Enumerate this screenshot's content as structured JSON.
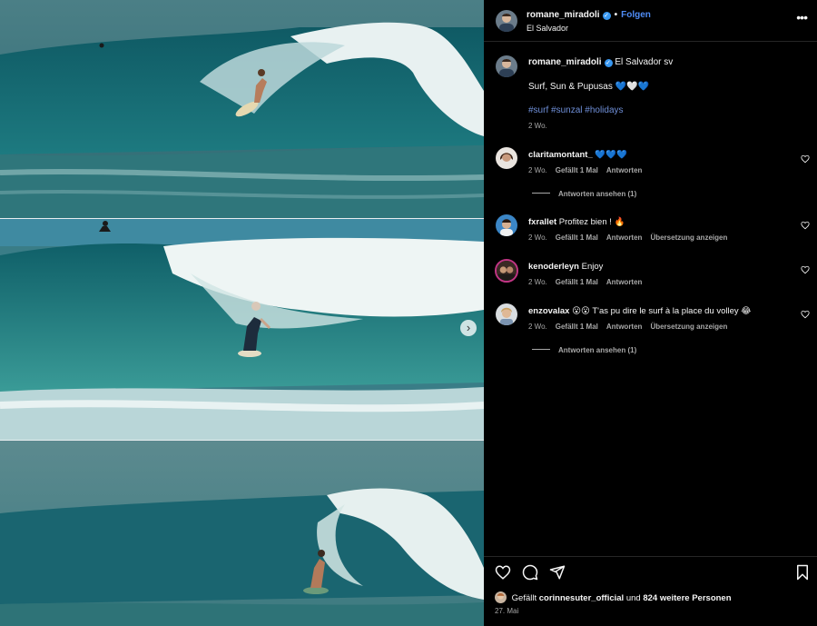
{
  "post": {
    "username": "romane_miradoli",
    "verified_symbol": "✓",
    "dot": "•",
    "follow_label": "Folgen",
    "location": "El Salvador",
    "more_icon": "more-horizontal-icon",
    "more_symbol": "•••"
  },
  "caption": {
    "username": "romane_miradoli",
    "location_tag": "El Salvador sv",
    "text": "Surf, Sun & Pupusas 💙🤍💙",
    "hashtags": [
      "#surf",
      "#sunzal",
      "#holidays"
    ],
    "time": "2 Wo."
  },
  "comments": [
    {
      "username": "claritamontant_",
      "text": "💙💙💙",
      "time": "2 Wo.",
      "likes": "Gefällt 1 Mal",
      "reply": "Antworten",
      "translate": "",
      "view_replies": "Antworten ansehen (1)"
    },
    {
      "username": "fxrallet",
      "text": "Profitez bien ! 🔥",
      "time": "2 Wo.",
      "likes": "Gefällt 1 Mal",
      "reply": "Antworten",
      "translate": "Übersetzung anzeigen",
      "view_replies": ""
    },
    {
      "username": "kenoderleyn",
      "text": "Enjoy",
      "time": "2 Wo.",
      "likes": "Gefällt 1 Mal",
      "reply": "Antworten",
      "translate": "",
      "view_replies": ""
    },
    {
      "username": "enzovalax",
      "text": "😮😮 T'as pu dire le surf à la place du volley 😂",
      "time": "2 Wo.",
      "likes": "Gefällt 1 Mal",
      "reply": "Antworten",
      "translate": "Übersetzung anzeigen",
      "view_replies": "Antworten ansehen (1)"
    }
  ],
  "actions": {
    "like_icon": "heart-icon",
    "comment_icon": "comment-icon",
    "share_icon": "share-icon",
    "save_icon": "bookmark-icon"
  },
  "likes": {
    "prefix": "Gefällt",
    "user": "corinnesuter_official",
    "middle": "und",
    "count": "824 weitere Personen"
  },
  "date": "27. Mai",
  "media": {
    "next_symbol": "›"
  },
  "colors": {
    "link": "#4f8cf5",
    "hashtag": "#6f8fd8",
    "verified": "#3897f0",
    "muted": "#a8a8a8",
    "ocean": "#1f6a7a"
  }
}
